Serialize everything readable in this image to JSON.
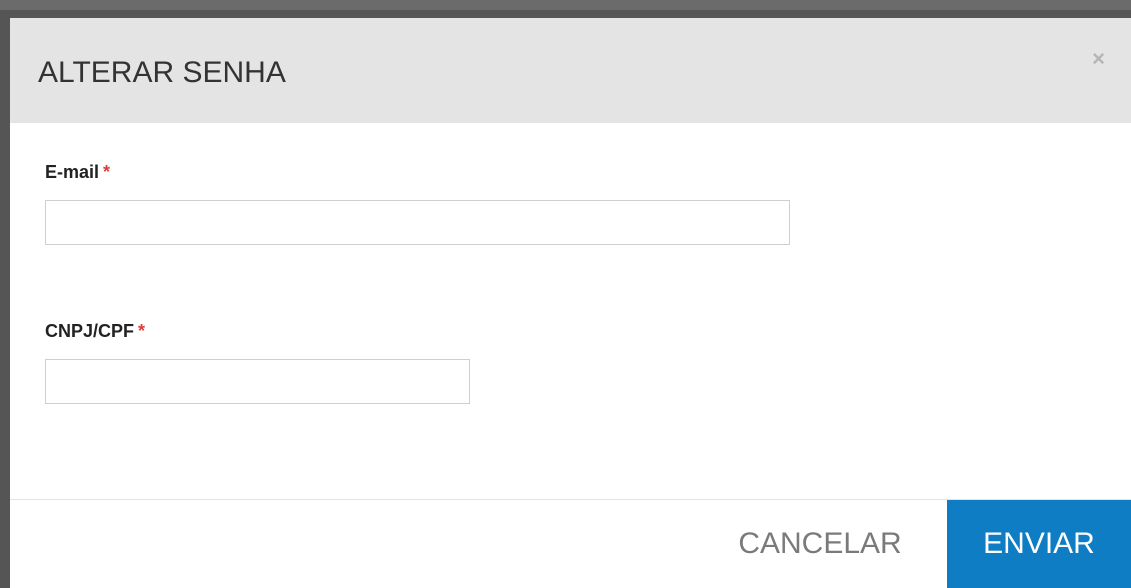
{
  "dialog": {
    "title": "ALTERAR SENHA",
    "close_symbol": "×"
  },
  "form": {
    "email": {
      "label": "E-mail",
      "required_mark": "*",
      "value": "",
      "placeholder": ""
    },
    "document": {
      "label": "CNPJ/CPF",
      "required_mark": "*",
      "value": "",
      "placeholder": ""
    }
  },
  "footer": {
    "cancel_label": "CANCELAR",
    "submit_label": "ENVIAR"
  },
  "colors": {
    "header_bg": "#e5e4e5",
    "required": "#e03a3a",
    "primary": "#0e7dc4",
    "overlay": "#555555"
  }
}
